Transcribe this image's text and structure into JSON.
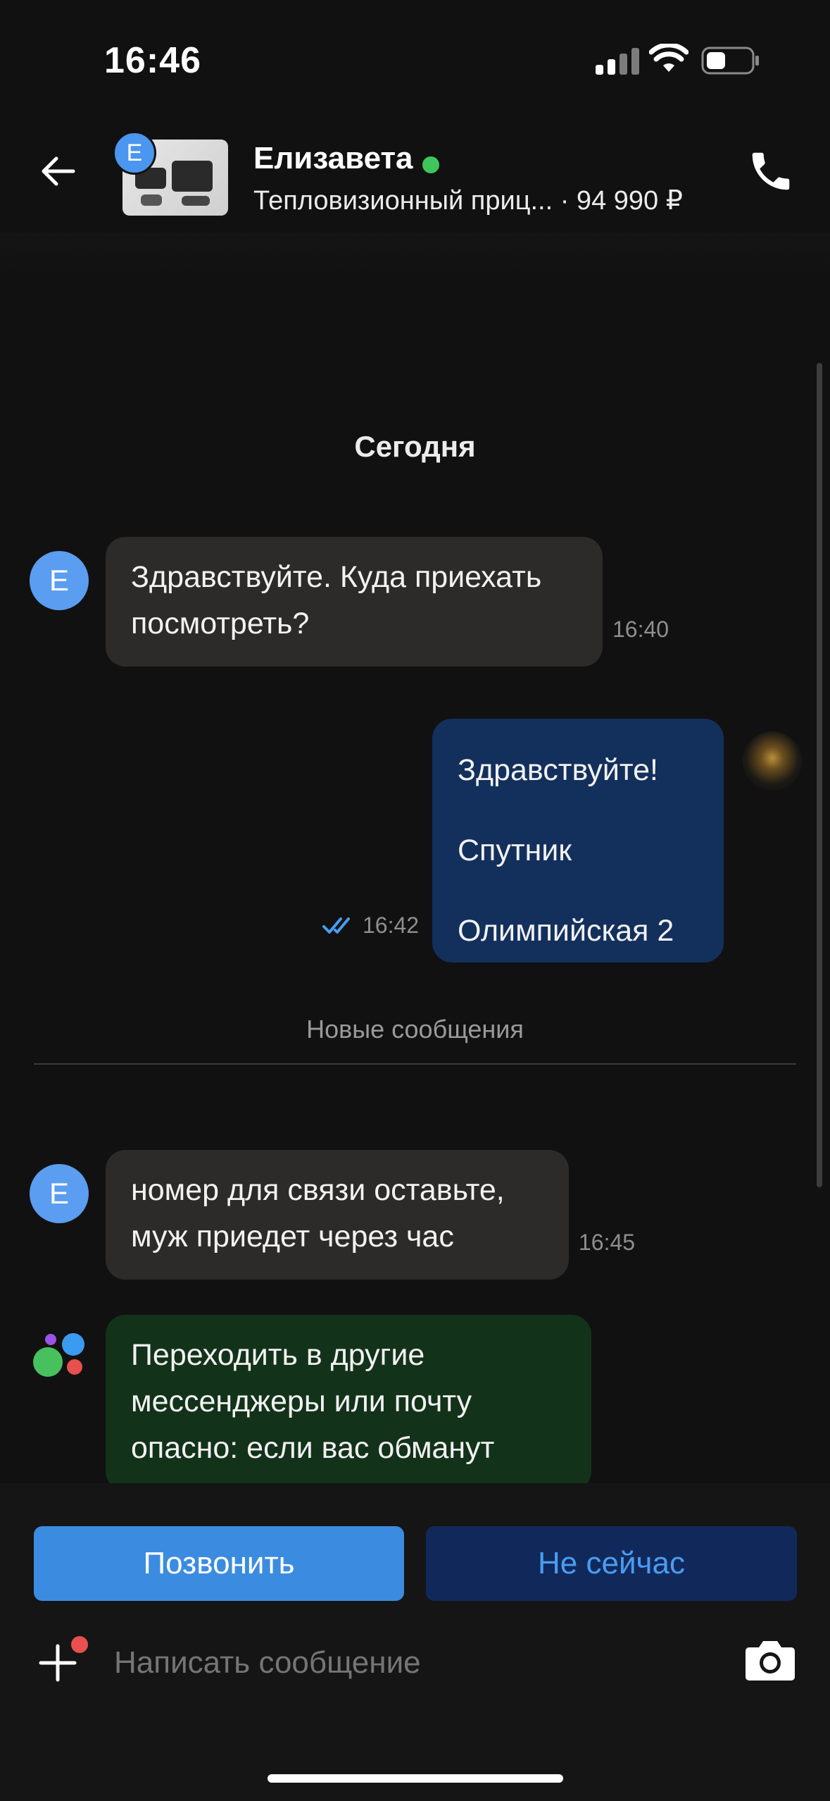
{
  "status": {
    "time": "16:46"
  },
  "header": {
    "avatar_letter": "E",
    "name": "Елизавета",
    "subtitle": "Тепловизионный приц... · 94 990 ₽",
    "online_color": "#3ec65c"
  },
  "chat": {
    "day_label": "Сегодня",
    "messages": [
      {
        "direction": "in",
        "avatar_letter": "E",
        "lines": [
          "Здравствуйте. Куда приехать",
          "посмотреть?"
        ],
        "time": "16:40"
      },
      {
        "direction": "out",
        "lines": [
          "Здравствуйте!",
          "Спутник",
          "Олимпийская 2"
        ],
        "time": "16:42",
        "status": "read"
      },
      {
        "direction": "in",
        "avatar_letter": "E",
        "lines": [
          "номер для связи оставьте,",
          "муж приедет через час"
        ],
        "time": "16:45"
      },
      {
        "direction": "system",
        "lines": [
          "Переходить в другие",
          "мессенджеры или почту",
          "опасно: если вас обманут"
        ]
      }
    ],
    "new_messages_label": "Новые сообщения"
  },
  "actions": {
    "call_label": "Позвонить",
    "later_label": "Не сейчас"
  },
  "composer": {
    "placeholder": "Написать сообщение"
  },
  "colors": {
    "accent": "#3b8ce0",
    "outgoing_bubble": "#13305d",
    "incoming_bubble": "#2d2b29",
    "system_bubble": "#13321a"
  },
  "icons": [
    "back-arrow-icon",
    "phone-icon",
    "double-check-icon",
    "plus-icon",
    "camera-icon",
    "signal-icon",
    "wifi-icon",
    "battery-icon",
    "app-logo-icon"
  ]
}
